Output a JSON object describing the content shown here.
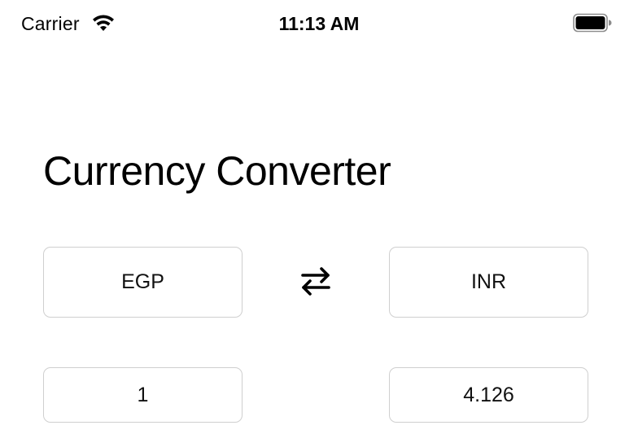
{
  "status_bar": {
    "carrier": "Carrier",
    "time": "11:13 AM",
    "icons": [
      "wifi-icon",
      "battery-icon"
    ]
  },
  "title": "Currency Converter",
  "converter": {
    "from_currency": "EGP",
    "to_currency": "INR",
    "from_amount": "1",
    "to_amount": "4.126",
    "swap_icon": "swap-arrows-icon"
  },
  "colors": {
    "background": "#ffffff",
    "text": "#000000",
    "border": "#cfcfcf"
  }
}
